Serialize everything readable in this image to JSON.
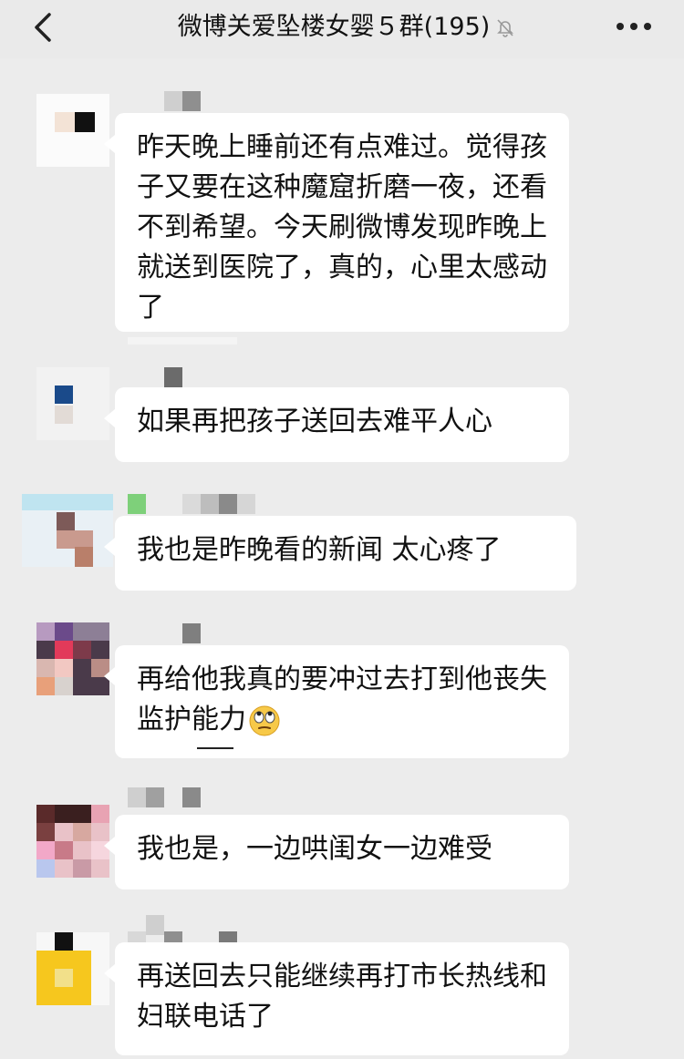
{
  "header": {
    "title": "微博关爱坠楼女婴５群(195)",
    "back_icon": "chevron-left-icon",
    "mute_icon": "bell-muted-icon",
    "more_icon": "more-dots-icon"
  },
  "messages": [
    {
      "text": "昨天晚上睡前还有点难过。觉得孩子又要在这种魔窟折磨一夜，还看不到希望。今天刷微博发现昨晚上就送到医院了，真的，心里太感动了"
    },
    {
      "text": "如果再把孩子送回去难平人心"
    },
    {
      "text": "我也是昨晚看的新闻 太心疼了"
    },
    {
      "text": "再给他我真的要冲过去打到他丧失监护能力",
      "emoji": "eye-roll-emoji-icon"
    },
    {
      "text": "我也是，一边哄闺女一边难受"
    },
    {
      "text": "再送回去只能继续再打市长热线和妇联电话了"
    }
  ]
}
